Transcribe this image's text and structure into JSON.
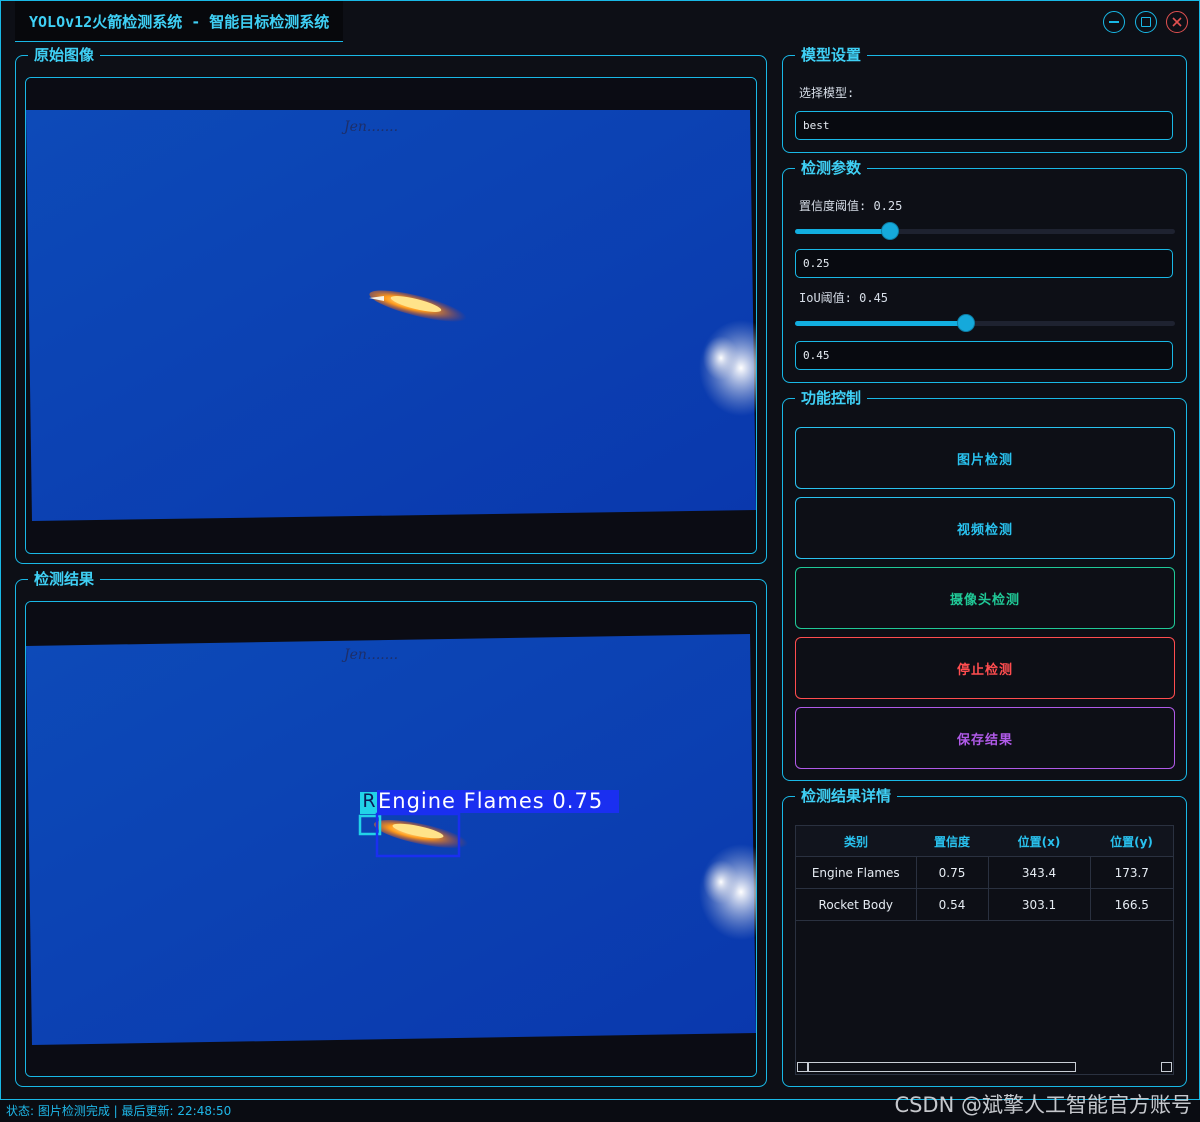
{
  "window": {
    "title": "YOLOv12火箭检测系统 - 智能目标检测系统"
  },
  "panels": {
    "original": {
      "title": "原始图像"
    },
    "result": {
      "title": "检测结果",
      "box_label_text": "Engine Flames 0.75",
      "box_label_second": "R"
    },
    "model": {
      "title": "模型设置",
      "select_label": "选择模型:",
      "select_value": "best"
    },
    "params": {
      "title": "检测参数",
      "conf_label": "置信度阈值: 0.25",
      "conf_value": 0.25,
      "conf_input": "0.25",
      "iou_label": "IoU阈值: 0.45",
      "iou_value": 0.45,
      "iou_input": "0.45"
    },
    "controls": {
      "title": "功能控制",
      "buttons": [
        {
          "label": "图片检测",
          "color": "#29c2ef"
        },
        {
          "label": "视频检测",
          "color": "#29c2ef"
        },
        {
          "label": "摄像头检测",
          "color": "#20c997"
        },
        {
          "label": "停止检测",
          "color": "#ff4d4f"
        },
        {
          "label": "保存结果",
          "color": "#b05ae8"
        }
      ]
    },
    "details": {
      "title": "检测结果详情",
      "columns": [
        "类别",
        "置信度",
        "位置(x)",
        "位置(y)"
      ],
      "rows": [
        [
          "Engine Flames",
          "0.75",
          "343.4",
          "173.7"
        ],
        [
          "Rocket Body",
          "0.54",
          "303.1",
          "166.5"
        ]
      ]
    }
  },
  "status": {
    "text": "状态: 图片检测完成 | 最后更新: 22:48:50"
  },
  "watermark": "CSDN @斌擎人工智能官方账号",
  "colors": {
    "accent": "#19b8e6",
    "background": "#0d0f16",
    "sky": "#0a3bb5"
  }
}
